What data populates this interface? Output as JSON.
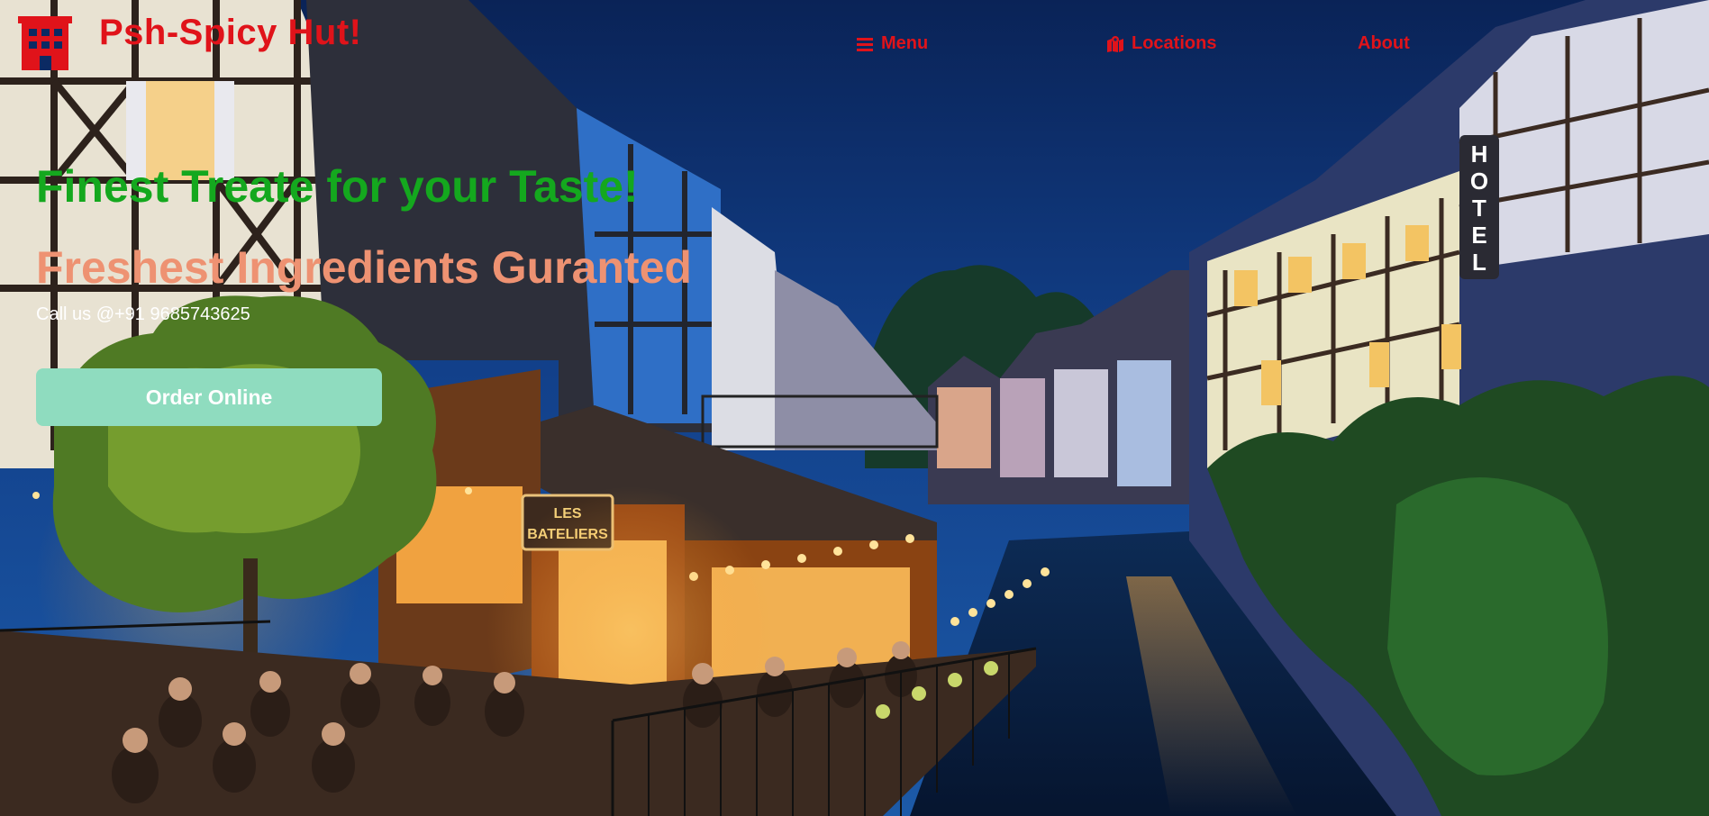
{
  "header": {
    "logo_icon": "building-icon",
    "brand_name": "Psh-Spicy Hut!",
    "nav": {
      "menu_label": "Menu",
      "menu_icon": "hamburger-icon",
      "locations_label": "Locations",
      "locations_icon": "map-icon",
      "about_label": "About"
    }
  },
  "hero": {
    "title": "Finest Treate for your Taste!",
    "subtitle": "Freshest Ingredients Guranted",
    "phone": "Call us @+91 9685743625",
    "order_button_label": "Order Online",
    "background": "night-canal-restaurant-photo"
  },
  "colors": {
    "brand_red": "#e0131a",
    "title_green": "#14a81e",
    "subtitle_salmon": "#ee9272",
    "button_mint": "#8fdcbf",
    "sky_blue": "#0b2a63"
  }
}
